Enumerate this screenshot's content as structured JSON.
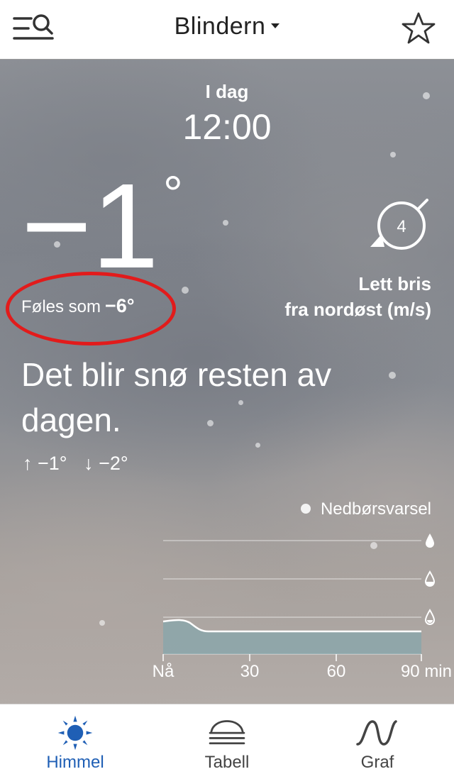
{
  "header": {
    "location": "Blindern",
    "menu_icon": "menu-search-icon",
    "favorite_icon": "star-icon"
  },
  "time": {
    "day": "I dag",
    "clock": "12:00"
  },
  "temperature": {
    "value": "−1",
    "degree": "°",
    "feels_like_label": "Føles som",
    "feels_like_value": "−6°"
  },
  "wind": {
    "speed": "4",
    "line1": "Lett bris",
    "line2": "fra nordøst (m/s)"
  },
  "summary": "Det blir snø resten av dagen.",
  "minmax": {
    "max": "↑ −1°",
    "min": "↓ −2°"
  },
  "precipitation": {
    "legend": "Nedbørsvarsel",
    "x_labels": [
      "Nå",
      "30",
      "60",
      "90 min"
    ]
  },
  "tabs": [
    {
      "label": "Himmel",
      "icon": "sun-icon",
      "active": true
    },
    {
      "label": "Tabell",
      "icon": "table-cloud-icon",
      "active": false
    },
    {
      "label": "Graf",
      "icon": "graph-wave-icon",
      "active": false
    }
  ],
  "colors": {
    "accent": "#1f5fb5",
    "highlight": "#e21b1b"
  }
}
